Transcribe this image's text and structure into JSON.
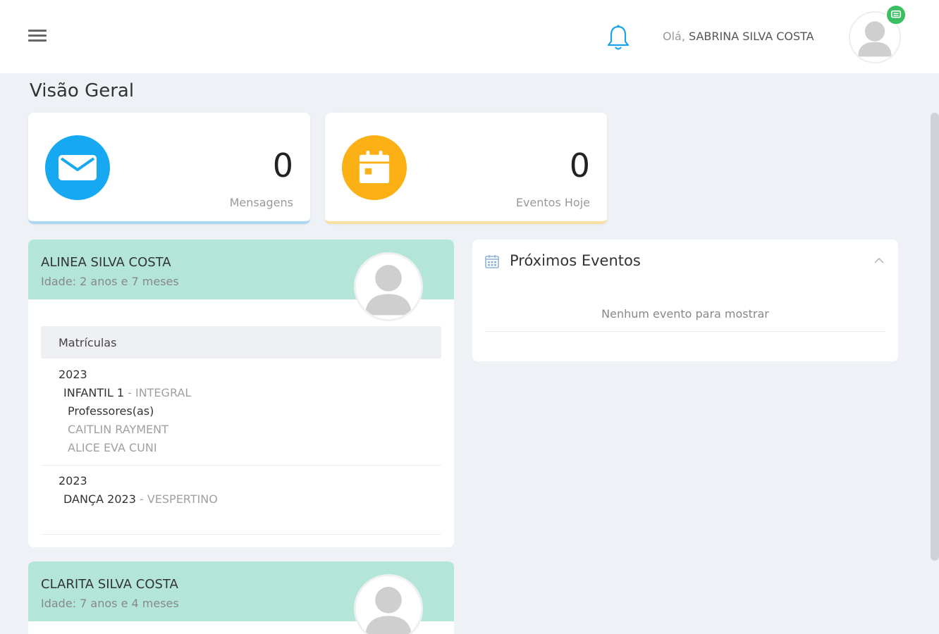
{
  "header": {
    "greeting_prefix": "Olá,",
    "user_name": "SABRINA SILVA COSTA"
  },
  "page": {
    "title": "Visão Geral"
  },
  "stats": [
    {
      "value": "0",
      "label": "Mensagens",
      "icon": "envelope-icon",
      "color": "#17a8f2"
    },
    {
      "value": "0",
      "label": "Eventos Hoje",
      "icon": "calendar-icon",
      "color": "#fbb116"
    }
  ],
  "children": [
    {
      "name": "ALINEA SILVA COSTA",
      "age": "Idade: 2 anos e 7 meses",
      "enrollments_title": "Matrículas",
      "enrollments": [
        {
          "year": "2023",
          "class_name": "INFANTIL 1",
          "shift": "- INTEGRAL",
          "teachers_label": "Professores(as)",
          "teachers": [
            "CAITLIN RAYMENT",
            "ALICE EVA CUNI"
          ]
        },
        {
          "year": "2023",
          "class_name": "DANÇA 2023",
          "shift": "- VESPERTINO"
        }
      ]
    },
    {
      "name": "CLARITA SILVA COSTA",
      "age": "Idade: 7 anos e 4 meses"
    }
  ],
  "events": {
    "title": "Próximos Eventos",
    "empty_text": "Nenhum evento para mostrar"
  },
  "colors": {
    "background": "#eef1f5",
    "child_header": "#b3e6d9",
    "messages_accent": "#17a8f2",
    "events_accent": "#fbb116",
    "online_badge": "#3cbf63"
  }
}
